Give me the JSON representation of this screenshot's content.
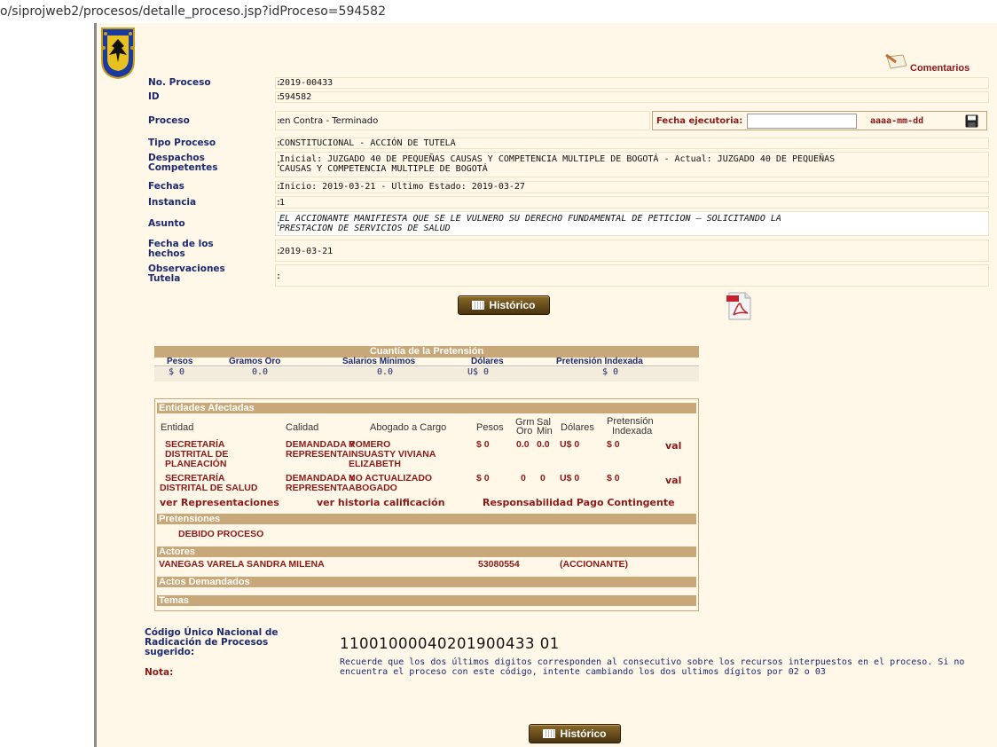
{
  "browser": {
    "url": "o/siprojweb2/procesos/detalle_proceso.jsp?idProceso=594582"
  },
  "comments": {
    "label": "Comentarios"
  },
  "info": {
    "no_proceso": {
      "label": "No. Proceso",
      "value": "2019-00433"
    },
    "id": {
      "label": "ID",
      "value": "594582"
    },
    "proceso": {
      "label": "Proceso",
      "value": "en Contra - Terminado"
    },
    "tipo_proceso": {
      "label": "Tipo Proceso",
      "value": "CONSTITUCIONAL - ACCIÓN DE TUTELA"
    },
    "despachos": {
      "label": "Despachos Competentes",
      "value_line1": "Inicial: JUZGADO 40 DE PEQUEÑAS CAUSAS Y COMPETENCIA MULTIPLE DE BOGOTÁ - Actual: JUZGADO 40 DE PEQUEÑAS",
      "value_line2": "CAUSAS Y COMPETENCIA MULTIPLE DE BOGOTÁ"
    },
    "fechas": {
      "label": "Fechas",
      "value": "Inicio: 2019-03-21 - Ultimo Estado: 2019-03-27"
    },
    "instancia": {
      "label": "Instancia",
      "value": "1"
    },
    "asunto": {
      "label": "Asunto",
      "value_line1": "EL ACCIONANTE MANIFIESTA QUE SE LE VULNERO SU DERECHO FUNDAMENTAL DE PETICION – SOLICITANDO LA",
      "value_line2": "PRESTACION DE SERVICIOS DE SALUD"
    },
    "fecha_hechos": {
      "label": "Fecha de los hechos",
      "value": "2019-03-21"
    },
    "observaciones": {
      "label": "Observaciones Tutela",
      "value": ""
    },
    "colon": ":"
  },
  "fecha_ejecutoria": {
    "label": "Fecha ejecutoria:",
    "input_value": "",
    "format": "aaaa-mm-dd"
  },
  "historico_button": "Histórico",
  "cuantia": {
    "title": "Cuantía de la Pretensión",
    "headers": [
      "Pesos",
      "Gramos Oro",
      "Salarios Mínimos",
      "Dólares",
      "Pretensión Indexada"
    ],
    "values": [
      "$ 0",
      "0.0",
      "0.0",
      "U$ 0",
      "$ 0"
    ]
  },
  "entidades": {
    "title": "Entidades Afectadas",
    "headers": {
      "entidad": "Entidad",
      "calidad": "Calidad",
      "abogado": "Abogado a Cargo",
      "pesos": "Pesos",
      "grm": "Grm",
      "oro": "Oro",
      "sal": "Sal",
      "min": "Min",
      "dolares": "Dólares",
      "pret1": "Pretensión",
      "pret2": "Indexada"
    },
    "rows": [
      {
        "entidad": [
          "SECRETARÍA",
          "DISTRITAL DE",
          "PLANEACIÓN"
        ],
        "calidad": [
          "DEMANDADA Y",
          "REPRESENTA"
        ],
        "abogado": [
          "ROMERO",
          "INSUASTY VIVIANA",
          "ELIZABETH"
        ],
        "pesos": "$ 0",
        "grm": "0.0",
        "sal": "0.0",
        "dolares": "U$ 0",
        "pret": "$ 0",
        "action": "val"
      },
      {
        "entidad": [
          "SECRETARÍA",
          "DISTRITAL DE SALUD"
        ],
        "calidad": [
          "DEMANDADA Y",
          "REPRESENTA"
        ],
        "abogado": [
          "NO ACTUALIZADO",
          "ABOGADO"
        ],
        "pesos": "$ 0",
        "grm": "0",
        "sal": "0",
        "dolares": "U$ 0",
        "pret": "$ 0",
        "action": "val"
      }
    ],
    "links": {
      "representaciones": "ver Representaciones",
      "historia": "ver historia calificación",
      "responsabilidad": "Responsabilidad Pago Contingente"
    }
  },
  "pretensiones": {
    "title": "Pretensiones",
    "item": "DEBIDO PROCESO"
  },
  "actores": {
    "title": "Actores",
    "name": "VANEGAS VARELA SANDRA MILENA",
    "doc": "53080554",
    "role": "(ACCIONANTE)"
  },
  "actos": {
    "title": "Actos Demandados"
  },
  "temas": {
    "title": "Temas"
  },
  "codigo": {
    "label_line1": "Código Único Nacional de",
    "label_line2": "Radicación de Procesos",
    "label_line3": "sugerido:",
    "value": "11001000040201900433 01"
  },
  "nota": {
    "label": "Nota:",
    "text_line1": "Recuerde que los dos últimos digitos corresponden al consecutivo sobre los recursos interpuestos en el proceso. Si no",
    "text_line2": "encuentra el proceso con este código, intente cambiando los dos ultimos dígitos por 02 o 03"
  },
  "colors": {
    "label_blue": "#1c2a6e",
    "accent_red": "#8a1a1a",
    "section_tan": "#c8a878",
    "page_bg": "#fff7e8"
  }
}
